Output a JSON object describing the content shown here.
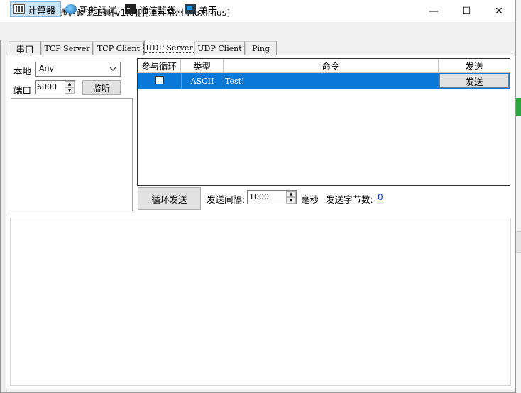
{
  "window": {
    "title": "C#超级通信调试工具[v1.0][][江苏常州-Maximus]",
    "min_glyph": "—",
    "max_glyph": "☐",
    "close_glyph": "✕"
  },
  "menu": {
    "items": [
      {
        "label": "计算器",
        "icon": "calculator-icon"
      },
      {
        "label": "新的调试",
        "icon": "globe-icon"
      },
      {
        "label": "通信监视",
        "icon": "terminal-icon"
      },
      {
        "label": "关于",
        "icon": "app-icon"
      }
    ]
  },
  "tabs": [
    {
      "label": "串口"
    },
    {
      "label": "TCP Server"
    },
    {
      "label": "TCP Client"
    },
    {
      "label": "UDP Server",
      "active": true
    },
    {
      "label": "UDP Client"
    },
    {
      "label": "Ping"
    }
  ],
  "config": {
    "local_label": "本地",
    "local_value": "Any",
    "port_label": "端口",
    "port_value": "6000",
    "listen_label": "监听"
  },
  "grid": {
    "columns": [
      "参与循环",
      "类型",
      "命令",
      "发送"
    ],
    "rows": [
      {
        "loop": false,
        "type": "ASCII",
        "command": "Test!",
        "send_label": "发送"
      }
    ]
  },
  "loop": {
    "loop_send_label": "循环发送",
    "interval_label": "发送间隔:",
    "interval_value": "1000",
    "ms_label": "毫秒",
    "bytes_label": "发送字节数:",
    "bytes_value": "0"
  },
  "colors": {
    "selection": "#0a78d7",
    "accent_link": "#0033cc"
  }
}
